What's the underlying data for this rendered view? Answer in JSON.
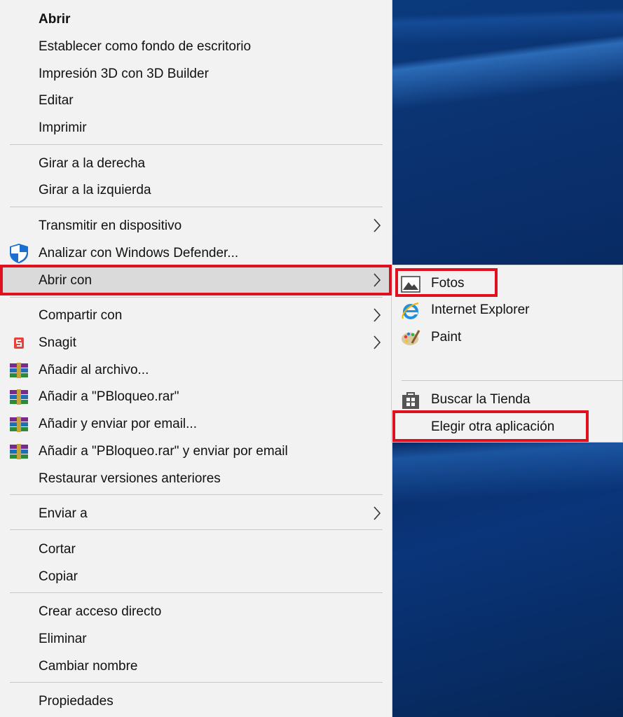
{
  "context_menu": {
    "items": [
      {
        "label": "Abrir",
        "bold": true
      },
      {
        "label": "Establecer como fondo de escritorio"
      },
      {
        "label": "Impresión 3D con 3D Builder"
      },
      {
        "label": "Editar"
      },
      {
        "label": "Imprimir"
      },
      {
        "label": "Girar a la derecha"
      },
      {
        "label": "Girar a la izquierda"
      },
      {
        "label": "Transmitir en dispositivo",
        "submenu": true
      },
      {
        "label": "Analizar con Windows Defender...",
        "icon": "windows-defender-shield-icon"
      },
      {
        "label": "Abrir con",
        "submenu": true,
        "highlighted": true
      },
      {
        "label": "Compartir con",
        "submenu": true
      },
      {
        "label": "Snagit",
        "submenu": true,
        "icon": "snagit-icon"
      },
      {
        "label": "Añadir al archivo...",
        "icon": "winrar-icon"
      },
      {
        "label": "Añadir a \"PBloqueo.rar\"",
        "icon": "winrar-icon"
      },
      {
        "label": "Añadir y enviar por email...",
        "icon": "winrar-icon"
      },
      {
        "label": "Añadir a \"PBloqueo.rar\" y enviar por email",
        "icon": "winrar-icon"
      },
      {
        "label": "Restaurar versiones anteriores"
      },
      {
        "label": "Enviar a",
        "submenu": true
      },
      {
        "label": "Cortar"
      },
      {
        "label": "Copiar"
      },
      {
        "label": "Crear acceso directo"
      },
      {
        "label": "Eliminar"
      },
      {
        "label": "Cambiar nombre"
      },
      {
        "label": "Propiedades"
      }
    ]
  },
  "open_with_submenu": {
    "items": [
      {
        "label": "Fotos",
        "icon": "photos-icon"
      },
      {
        "label": "Internet Explorer",
        "icon": "internet-explorer-icon"
      },
      {
        "label": "Paint",
        "icon": "paint-icon"
      },
      {
        "label": "Buscar la Tienda",
        "icon": "store-icon"
      },
      {
        "label": "Elegir otra aplicación"
      }
    ]
  },
  "colors": {
    "menu_background": "#f2f2f2",
    "highlight": "#dadada",
    "annotation_red": "#e0111e",
    "desktop_blue": "#0b3270"
  }
}
